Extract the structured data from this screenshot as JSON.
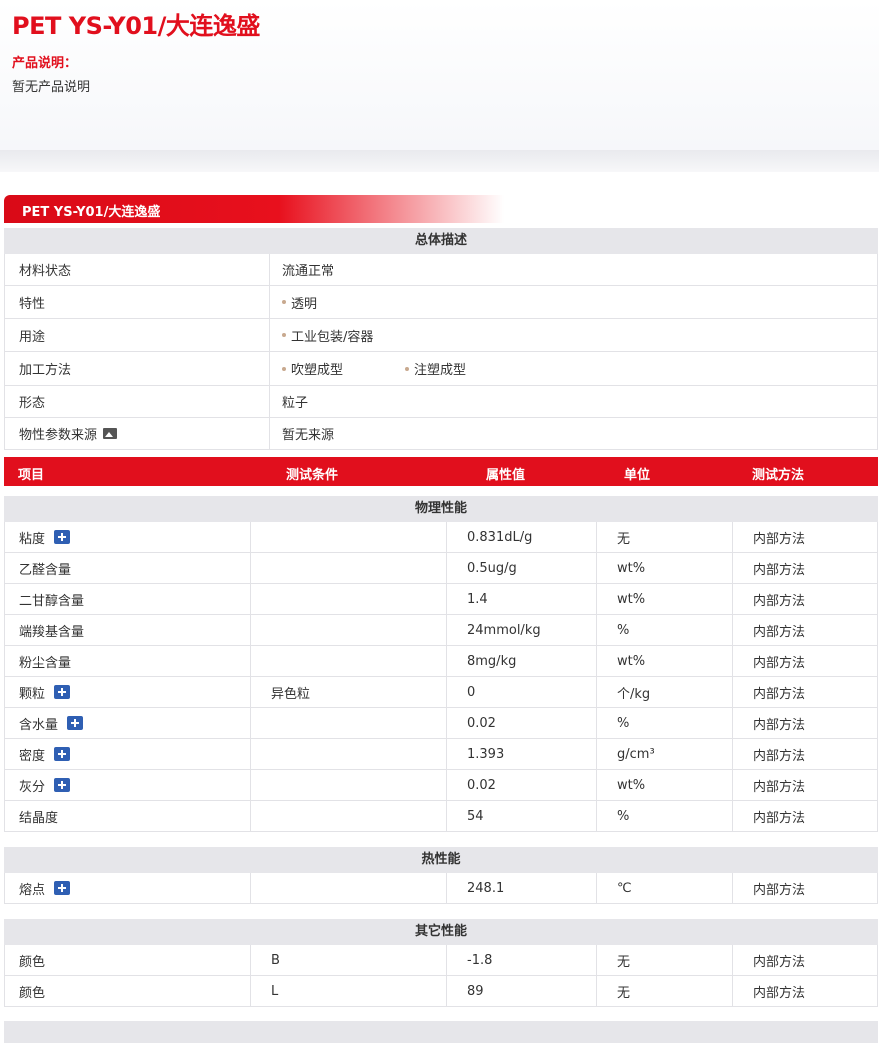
{
  "header": {
    "title": "PET YS-Y01/大连逸盛",
    "desc_label": "产品说明：",
    "desc_text": "暂无产品说明"
  },
  "banner": {
    "title": "PET YS-Y01/大连逸盛"
  },
  "overview": {
    "heading": "总体描述",
    "rows": [
      {
        "label": "材料状态",
        "values": [
          "流通正常"
        ],
        "bullets": false
      },
      {
        "label": "特性",
        "values": [
          "透明"
        ],
        "bullets": true
      },
      {
        "label": "用途",
        "values": [
          "工业包装/容器"
        ],
        "bullets": true
      },
      {
        "label": "加工方法",
        "values": [
          "吹塑成型",
          "注塑成型"
        ],
        "bullets": true
      },
      {
        "label": "形态",
        "values": [
          "粒子"
        ],
        "bullets": false
      },
      {
        "label": "物性参数来源",
        "values": [
          "暂无来源"
        ],
        "bullets": false,
        "icon": "image-icon"
      }
    ]
  },
  "table_header": {
    "item": "项目",
    "condition": "测试条件",
    "value": "属性值",
    "unit": "单位",
    "method": "测试方法"
  },
  "sections": [
    {
      "heading": "物理性能",
      "rows": [
        {
          "item": "粘度",
          "plus": true,
          "condition": "",
          "value": "0.831dL/g",
          "unit": "无",
          "method": "内部方法"
        },
        {
          "item": "乙醛含量",
          "plus": false,
          "condition": "",
          "value": "0.5ug/g",
          "unit": "wt%",
          "method": "内部方法"
        },
        {
          "item": "二甘醇含量",
          "plus": false,
          "condition": "",
          "value": "1.4",
          "unit": "wt%",
          "method": "内部方法"
        },
        {
          "item": "端羧基含量",
          "plus": false,
          "condition": "",
          "value": "24mmol/kg",
          "unit": "%",
          "method": "内部方法"
        },
        {
          "item": "粉尘含量",
          "plus": false,
          "condition": "",
          "value": "8mg/kg",
          "unit": "wt%",
          "method": "内部方法"
        },
        {
          "item": "颗粒",
          "plus": true,
          "condition": "异色粒",
          "value": "0",
          "unit": "个/kg",
          "method": "内部方法"
        },
        {
          "item": "含水量",
          "plus": true,
          "condition": "",
          "value": "0.02",
          "unit": "%",
          "method": "内部方法"
        },
        {
          "item": "密度",
          "plus": true,
          "condition": "",
          "value": "1.393",
          "unit": "g/cm³",
          "method": "内部方法"
        },
        {
          "item": "灰分",
          "plus": true,
          "condition": "",
          "value": "0.02",
          "unit": "wt%",
          "method": "内部方法"
        },
        {
          "item": "结晶度",
          "plus": false,
          "condition": "",
          "value": "54",
          "unit": "%",
          "method": "内部方法"
        }
      ]
    },
    {
      "heading": "热性能",
      "rows": [
        {
          "item": "熔点",
          "plus": true,
          "condition": "",
          "value": "248.1",
          "unit": "℃",
          "method": "内部方法"
        }
      ]
    },
    {
      "heading": "其它性能",
      "rows": [
        {
          "item": "颜色",
          "plus": false,
          "condition": "B",
          "value": "-1.8",
          "unit": "无",
          "method": "内部方法"
        },
        {
          "item": "颜色",
          "plus": false,
          "condition": "L",
          "value": "89",
          "unit": "无",
          "method": "内部方法"
        }
      ]
    }
  ],
  "colors": {
    "accent": "#e10f1d",
    "section_bg": "#e6e6ea",
    "plus_icon": "#2f5fb3"
  }
}
